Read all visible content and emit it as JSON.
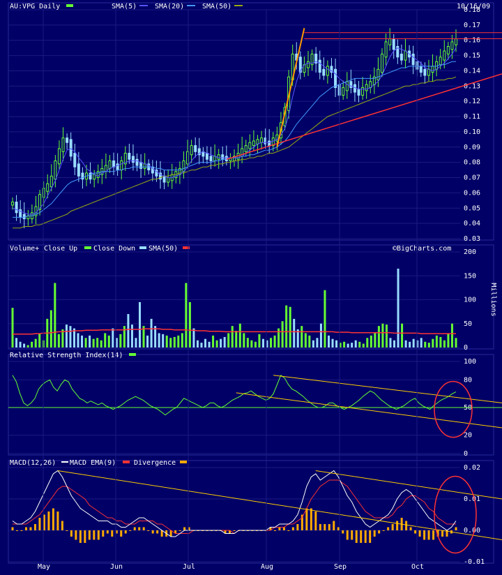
{
  "chart_data": [
    {
      "type": "line",
      "panel": "price",
      "title": "AU:VPG Daily",
      "date": "10/16/09",
      "ylim": [
        0.03,
        0.18
      ],
      "yticks": [
        "0.18",
        "0.17",
        "0.16",
        "0.15",
        "0.14",
        "0.13",
        "0.12",
        "0.11",
        "0.10",
        "0.09",
        "0.08",
        "0.07",
        "0.06",
        "0.05",
        "0.04",
        "0.03"
      ],
      "xticks": [
        "May",
        "Jun",
        "Jul",
        "Aug",
        "Sep",
        "Oct"
      ],
      "legend": [
        "SMA(5)",
        "SMA(20)",
        "SMA(50)"
      ],
      "colors": {
        "price_up": "#66ff33",
        "price_down": "#99ddff",
        "sma5": "#5555ff",
        "sma20": "#4499ff",
        "sma50": "#99aa11",
        "trendline_orange": "#ff9900",
        "trendline_red": "#ff3333"
      },
      "x": [
        0,
        1,
        2,
        3,
        4,
        5,
        6,
        7,
        8,
        9,
        10,
        11,
        12,
        13,
        14,
        15,
        16,
        17,
        18,
        19,
        20,
        21,
        22,
        23,
        24,
        25,
        26,
        27,
        28,
        29,
        30,
        31,
        32,
        33,
        34,
        35,
        36,
        37,
        38,
        39,
        40,
        41,
        42,
        43,
        44,
        45,
        46,
        47,
        48,
        49,
        50,
        51,
        52,
        53,
        54,
        55,
        56,
        57,
        58,
        59,
        60,
        61,
        62,
        63,
        64,
        65,
        66,
        67,
        68,
        69,
        70,
        71,
        72,
        73,
        74,
        75,
        76,
        77,
        78,
        79,
        80,
        81,
        82,
        83,
        84,
        85,
        86,
        87,
        88,
        89,
        90,
        91,
        92,
        93,
        94,
        95,
        96,
        97,
        98,
        99,
        100,
        101,
        102,
        103,
        104,
        105,
        106,
        107,
        108,
        109,
        110,
        111,
        112,
        113,
        114,
        115,
        116,
        117,
        118,
        119,
        120,
        121,
        122,
        123,
        124,
        125,
        126,
        127,
        128,
        129,
        130,
        131,
        132,
        133,
        134,
        135,
        136,
        137,
        138,
        139,
        140,
        141,
        142,
        143,
        144,
        145,
        146,
        147,
        148,
        149,
        150
      ],
      "close": [
        0.053,
        0.048,
        0.045,
        0.044,
        0.044,
        0.046,
        0.05,
        0.058,
        0.062,
        0.065,
        0.07,
        0.08,
        0.088,
        0.095,
        0.094,
        0.085,
        0.078,
        0.072,
        0.07,
        0.072,
        0.07,
        0.071,
        0.073,
        0.075,
        0.077,
        0.08,
        0.078,
        0.076,
        0.08,
        0.085,
        0.083,
        0.081,
        0.079,
        0.077,
        0.078,
        0.076,
        0.074,
        0.072,
        0.07,
        0.068,
        0.069,
        0.071,
        0.073,
        0.075,
        0.08,
        0.086,
        0.09,
        0.088,
        0.086,
        0.085,
        0.083,
        0.082,
        0.083,
        0.084,
        0.083,
        0.082,
        0.082,
        0.083,
        0.085,
        0.088,
        0.09,
        0.092,
        0.093,
        0.094,
        0.095,
        0.093,
        0.092,
        0.095,
        0.097,
        0.105,
        0.115,
        0.135,
        0.15,
        0.148,
        0.14,
        0.143,
        0.145,
        0.15,
        0.146,
        0.14,
        0.138,
        0.142,
        0.14,
        0.13,
        0.125,
        0.128,
        0.132,
        0.13,
        0.127,
        0.125,
        0.128,
        0.13,
        0.132,
        0.135,
        0.14,
        0.15,
        0.158,
        0.16,
        0.155,
        0.15,
        0.148,
        0.152,
        0.15,
        0.145,
        0.142,
        0.14,
        0.138,
        0.14,
        0.142,
        0.145,
        0.148,
        0.152,
        0.155,
        0.158,
        0.16
      ],
      "sma5": [
        0.05,
        0.049,
        0.048,
        0.047,
        0.046,
        0.046,
        0.047,
        0.05,
        0.053,
        0.058,
        0.063,
        0.068,
        0.075,
        0.082,
        0.088,
        0.089,
        0.087,
        0.083,
        0.08,
        0.076,
        0.074,
        0.072,
        0.071,
        0.073,
        0.074,
        0.076,
        0.077,
        0.078,
        0.079,
        0.08,
        0.081,
        0.081,
        0.081,
        0.08,
        0.079,
        0.078,
        0.076,
        0.074,
        0.072,
        0.071,
        0.07,
        0.07,
        0.071,
        0.072,
        0.074,
        0.077,
        0.081,
        0.084,
        0.086,
        0.087,
        0.086,
        0.085,
        0.084,
        0.083,
        0.083,
        0.083,
        0.083,
        0.083,
        0.083,
        0.084,
        0.086,
        0.088,
        0.09,
        0.092,
        0.093,
        0.093,
        0.093,
        0.094,
        0.095,
        0.098,
        0.102,
        0.111,
        0.123,
        0.133,
        0.14,
        0.144,
        0.145,
        0.145,
        0.146,
        0.145,
        0.143,
        0.141,
        0.14,
        0.138,
        0.135,
        0.133,
        0.131,
        0.13,
        0.129,
        0.128,
        0.128,
        0.128,
        0.129,
        0.131,
        0.133,
        0.137,
        0.143,
        0.149,
        0.153,
        0.155,
        0.154,
        0.153,
        0.151,
        0.149,
        0.147,
        0.145,
        0.142,
        0.141,
        0.14,
        0.141,
        0.143,
        0.145,
        0.148,
        0.151,
        0.155
      ],
      "sma20": [
        0.044,
        0.044,
        0.044,
        0.044,
        0.045,
        0.045,
        0.046,
        0.047,
        0.049,
        0.051,
        0.053,
        0.056,
        0.059,
        0.062,
        0.065,
        0.067,
        0.068,
        0.069,
        0.07,
        0.071,
        0.072,
        0.073,
        0.073,
        0.074,
        0.074,
        0.074,
        0.074,
        0.075,
        0.075,
        0.076,
        0.076,
        0.077,
        0.077,
        0.077,
        0.077,
        0.077,
        0.077,
        0.076,
        0.076,
        0.075,
        0.075,
        0.075,
        0.075,
        0.075,
        0.076,
        0.077,
        0.078,
        0.079,
        0.08,
        0.08,
        0.08,
        0.08,
        0.081,
        0.081,
        0.082,
        0.082,
        0.083,
        0.083,
        0.083,
        0.084,
        0.084,
        0.085,
        0.085,
        0.086,
        0.087,
        0.088,
        0.088,
        0.089,
        0.09,
        0.092,
        0.094,
        0.097,
        0.101,
        0.105,
        0.108,
        0.111,
        0.114,
        0.117,
        0.12,
        0.123,
        0.125,
        0.127,
        0.129,
        0.13,
        0.131,
        0.132,
        0.133,
        0.134,
        0.135,
        0.135,
        0.135,
        0.135,
        0.135,
        0.135,
        0.136,
        0.137,
        0.138,
        0.139,
        0.14,
        0.141,
        0.142,
        0.142,
        0.143,
        0.143,
        0.143,
        0.143,
        0.143,
        0.143,
        0.143,
        0.143,
        0.144,
        0.144,
        0.145,
        0.146,
        0.146
      ],
      "sma50": [
        0.037,
        0.037,
        0.037,
        0.038,
        0.038,
        0.038,
        0.039,
        0.039,
        0.04,
        0.041,
        0.042,
        0.043,
        0.044,
        0.045,
        0.046,
        0.048,
        0.049,
        0.05,
        0.051,
        0.052,
        0.053,
        0.054,
        0.055,
        0.056,
        0.057,
        0.058,
        0.059,
        0.06,
        0.061,
        0.062,
        0.063,
        0.064,
        0.065,
        0.066,
        0.067,
        0.068,
        0.069,
        0.069,
        0.07,
        0.071,
        0.071,
        0.072,
        0.072,
        0.073,
        0.073,
        0.074,
        0.075,
        0.075,
        0.076,
        0.077,
        0.077,
        0.078,
        0.078,
        0.079,
        0.079,
        0.08,
        0.08,
        0.081,
        0.081,
        0.082,
        0.082,
        0.083,
        0.083,
        0.084,
        0.084,
        0.085,
        0.086,
        0.086,
        0.087,
        0.088,
        0.089,
        0.09,
        0.092,
        0.094,
        0.096,
        0.098,
        0.1,
        0.102,
        0.104,
        0.106,
        0.108,
        0.11,
        0.111,
        0.112,
        0.113,
        0.114,
        0.115,
        0.116,
        0.117,
        0.118,
        0.119,
        0.12,
        0.121,
        0.122,
        0.123,
        0.124,
        0.125,
        0.126,
        0.127,
        0.128,
        0.129,
        0.13,
        0.13,
        0.131,
        0.131,
        0.132,
        0.132,
        0.133,
        0.133,
        0.134,
        0.134,
        0.134,
        0.135,
        0.135,
        0.136
      ]
    },
    {
      "type": "bar",
      "panel": "volume",
      "title": "Volume+",
      "legend": [
        "Close Up",
        "Close Down",
        "SMA(50)"
      ],
      "ylabel": "Millions",
      "ylim": [
        0,
        200
      ],
      "yticks": [
        "200",
        "150",
        "100",
        "50",
        "0"
      ],
      "watermark": "©BigCharts.com",
      "values": [
        83,
        20,
        12,
        8,
        5,
        12,
        18,
        30,
        15,
        60,
        78,
        135,
        28,
        38,
        48,
        45,
        40,
        30,
        25,
        20,
        25,
        18,
        20,
        15,
        30,
        25,
        40,
        20,
        28,
        45,
        70,
        48,
        20,
        95,
        45,
        25,
        60,
        45,
        30,
        28,
        25,
        20,
        22,
        25,
        30,
        135,
        95,
        40,
        15,
        10,
        18,
        12,
        25,
        15,
        18,
        22,
        30,
        45,
        35,
        50,
        30,
        20,
        15,
        12,
        28,
        18,
        15,
        20,
        25,
        40,
        55,
        88,
        85,
        60,
        38,
        45,
        30,
        25,
        15,
        20,
        50,
        120,
        25,
        18,
        15,
        10,
        12,
        8,
        10,
        15,
        12,
        8,
        20,
        25,
        30,
        45,
        50,
        48,
        20,
        15,
        165,
        50,
        15,
        12,
        18,
        15,
        20,
        12,
        10,
        18,
        25,
        22,
        15,
        30,
        50,
        20
      ],
      "sma50": [
        28,
        28,
        28,
        28,
        28,
        28,
        29,
        29,
        30,
        30,
        31,
        32,
        33,
        33,
        34,
        34,
        35,
        35,
        35,
        36,
        36,
        36,
        36,
        37,
        37,
        37,
        37,
        37,
        37,
        37,
        38,
        38,
        38,
        38,
        39,
        39,
        39,
        39,
        39,
        38,
        38,
        38,
        37,
        37,
        37,
        37,
        36,
        36,
        35,
        35,
        35,
        34,
        34,
        34,
        34,
        33,
        33,
        33,
        33,
        33,
        33,
        33,
        33,
        33,
        33,
        33,
        33,
        33,
        33,
        33,
        33,
        33,
        33,
        33,
        33,
        33,
        33,
        33,
        33,
        33,
        33,
        33,
        33,
        33,
        32,
        32,
        32,
        32,
        31,
        31,
        31,
        31,
        31,
        31,
        31,
        31,
        31,
        31,
        31,
        30,
        30,
        30,
        30,
        30,
        30,
        30,
        29,
        29,
        29,
        29,
        29,
        29,
        29,
        29,
        29,
        29
      ]
    },
    {
      "type": "line",
      "panel": "rsi",
      "title": "Relative Strength Index(14)",
      "ylim": [
        0,
        100
      ],
      "yticks": [
        "100",
        "80",
        "50",
        "20",
        "0"
      ],
      "values": [
        85,
        78,
        65,
        55,
        52,
        55,
        60,
        70,
        75,
        78,
        80,
        72,
        68,
        75,
        80,
        78,
        70,
        65,
        60,
        58,
        55,
        57,
        55,
        53,
        55,
        52,
        50,
        48,
        50,
        52,
        55,
        58,
        60,
        62,
        60,
        58,
        55,
        52,
        50,
        48,
        45,
        42,
        45,
        48,
        50,
        55,
        60,
        58,
        56,
        54,
        52,
        50,
        52,
        55,
        55,
        52,
        50,
        52,
        55,
        58,
        60,
        62,
        65,
        66,
        68,
        65,
        62,
        60,
        58,
        60,
        65,
        75,
        85,
        82,
        75,
        70,
        68,
        65,
        62,
        58,
        55,
        52,
        50,
        50,
        52,
        55,
        55,
        52,
        50,
        48,
        50,
        52,
        55,
        58,
        62,
        65,
        68,
        66,
        62,
        58,
        55,
        52,
        50,
        48,
        50,
        52,
        55,
        58,
        60,
        55,
        52,
        50,
        48,
        52,
        55,
        58,
        60,
        62,
        65,
        67
      ]
    },
    {
      "type": "line",
      "panel": "macd",
      "title": "MACD(12,26)",
      "legend": [
        "MACD EMA(9)",
        "Divergence"
      ],
      "ylim": [
        -0.01,
        0.02
      ],
      "yticks": [
        "0.02",
        "0.01",
        "0.00",
        "-0.01"
      ],
      "macd": [
        0.003,
        0.002,
        0.002,
        0.003,
        0.004,
        0.006,
        0.009,
        0.012,
        0.015,
        0.018,
        0.019,
        0.017,
        0.014,
        0.011,
        0.009,
        0.007,
        0.006,
        0.005,
        0.004,
        0.003,
        0.003,
        0.003,
        0.002,
        0.002,
        0.001,
        0.001,
        0.002,
        0.003,
        0.004,
        0.004,
        0.003,
        0.002,
        0.001,
        0.0,
        -0.001,
        -0.002,
        -0.002,
        -0.001,
        0.0,
        0.0,
        0.0,
        0.0,
        0.0,
        0.0,
        0.0,
        0.0,
        0.0,
        -0.001,
        -0.001,
        -0.001,
        0.0,
        0.0,
        0.0,
        0.0,
        0.0,
        0.0,
        0.0,
        0.001,
        0.001,
        0.002,
        0.002,
        0.002,
        0.003,
        0.005,
        0.009,
        0.014,
        0.017,
        0.018,
        0.016,
        0.017,
        0.018,
        0.019,
        0.017,
        0.014,
        0.011,
        0.009,
        0.006,
        0.004,
        0.002,
        0.001,
        0.002,
        0.003,
        0.004,
        0.005,
        0.007,
        0.01,
        0.012,
        0.013,
        0.012,
        0.01,
        0.008,
        0.006,
        0.004,
        0.003,
        0.002,
        0.001,
        0.0,
        0.001,
        0.003
      ],
      "signal": [
        0.002,
        0.002,
        0.002,
        0.002,
        0.003,
        0.004,
        0.005,
        0.007,
        0.009,
        0.011,
        0.013,
        0.014,
        0.014,
        0.013,
        0.012,
        0.011,
        0.01,
        0.008,
        0.007,
        0.006,
        0.005,
        0.004,
        0.004,
        0.003,
        0.003,
        0.002,
        0.002,
        0.002,
        0.003,
        0.003,
        0.003,
        0.003,
        0.002,
        0.002,
        0.001,
        0.0,
        -0.001,
        -0.001,
        -0.001,
        -0.001,
        0.0,
        0.0,
        0.0,
        0.0,
        0.0,
        0.0,
        0.0,
        0.0,
        0.0,
        -0.001,
        0.0,
        0.0,
        0.0,
        0.0,
        0.0,
        0.0,
        0.0,
        0.0,
        0.001,
        0.001,
        0.001,
        0.002,
        0.002,
        0.003,
        0.004,
        0.007,
        0.01,
        0.012,
        0.014,
        0.015,
        0.016,
        0.016,
        0.016,
        0.015,
        0.014,
        0.012,
        0.01,
        0.008,
        0.006,
        0.005,
        0.004,
        0.004,
        0.004,
        0.004,
        0.005,
        0.007,
        0.008,
        0.01,
        0.011,
        0.011,
        0.01,
        0.009,
        0.007,
        0.006,
        0.004,
        0.003,
        0.002,
        0.002,
        0.002
      ],
      "divergence": [
        0.001,
        0.0,
        0.0,
        0.001,
        0.001,
        0.002,
        0.004,
        0.005,
        0.006,
        0.007,
        0.006,
        0.003,
        0.0,
        -0.002,
        -0.003,
        -0.004,
        -0.004,
        -0.003,
        -0.003,
        -0.003,
        -0.002,
        -0.001,
        -0.002,
        -0.001,
        -0.002,
        -0.001,
        0.0,
        0.001,
        0.001,
        0.001,
        0.0,
        -0.001,
        -0.001,
        -0.002,
        -0.002,
        -0.002,
        -0.001,
        0.0,
        0.001,
        0.001,
        0.0,
        0.0,
        0.0,
        0.0,
        0.0,
        0.0,
        0.0,
        -0.001,
        -0.001,
        0.0,
        0.0,
        0.0,
        0.0,
        0.0,
        0.0,
        0.0,
        0.0,
        0.001,
        0.0,
        0.001,
        0.001,
        0.0,
        0.001,
        0.002,
        0.005,
        0.007,
        0.007,
        0.006,
        0.002,
        0.002,
        0.002,
        0.003,
        0.001,
        -0.001,
        -0.003,
        -0.003,
        -0.004,
        -0.004,
        -0.004,
        -0.004,
        -0.002,
        -0.001,
        0.0,
        0.001,
        0.002,
        0.003,
        0.004,
        0.003,
        0.001,
        -0.001,
        -0.002,
        -0.003,
        -0.003,
        -0.003,
        -0.002,
        -0.002,
        -0.002,
        -0.001,
        0.001
      ]
    }
  ]
}
